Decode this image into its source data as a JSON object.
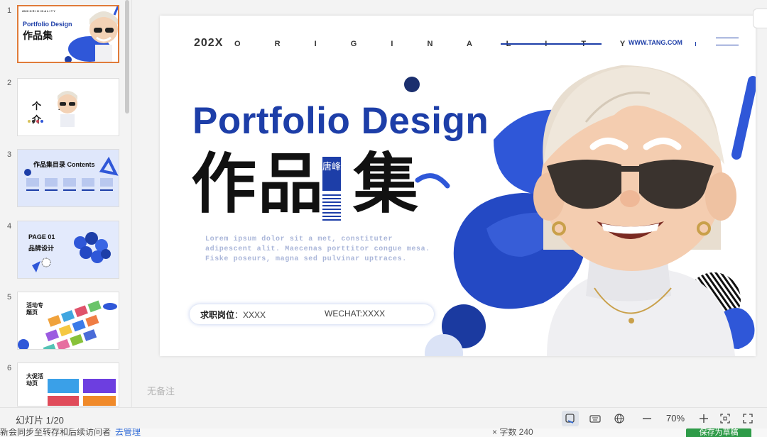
{
  "thumbnails": [
    {
      "num": "1",
      "title": "Portfolio Design",
      "cn": "作品集",
      "active": true
    },
    {
      "num": "2",
      "title": "个人简介",
      "cn": "个人 介"
    },
    {
      "num": "3",
      "title": "作品集目录 Contents"
    },
    {
      "num": "4",
      "title": "PAGE 01",
      "sub": "品牌设计"
    },
    {
      "num": "5",
      "title": "活动专题页"
    },
    {
      "num": "6",
      "title": "大促活动页"
    }
  ],
  "slide": {
    "year": "202X",
    "originality": "O R I G I N A L I T Y",
    "url": "WWW.TANG.COM",
    "title": "Portfolio Design",
    "cn_left": "作品",
    "cn_right": "集",
    "tag": "唐峰",
    "lorem": "Lorem ipsum dolor sit a met, constituter adipescent alit. Maecenas porttitor congue mesa. Fiske poseurs, magna sed pulvinar uptraces.",
    "job_label": "求职岗位",
    "job_value": "：XXXX",
    "wechat": "WECHAT:XXXX"
  },
  "notes_placeholder": "无备注",
  "status": {
    "slides_label": "幻灯片 1/20",
    "zoom": "70%"
  },
  "bottom": {
    "left_text": "新会同步至转存和后续访问者",
    "link": "去管理",
    "mid_text": "× 字数 240",
    "green_btn": "保存为草稿"
  },
  "colors": {
    "accent": "#1d3ea8",
    "selected_thumb": "#e07b39"
  }
}
